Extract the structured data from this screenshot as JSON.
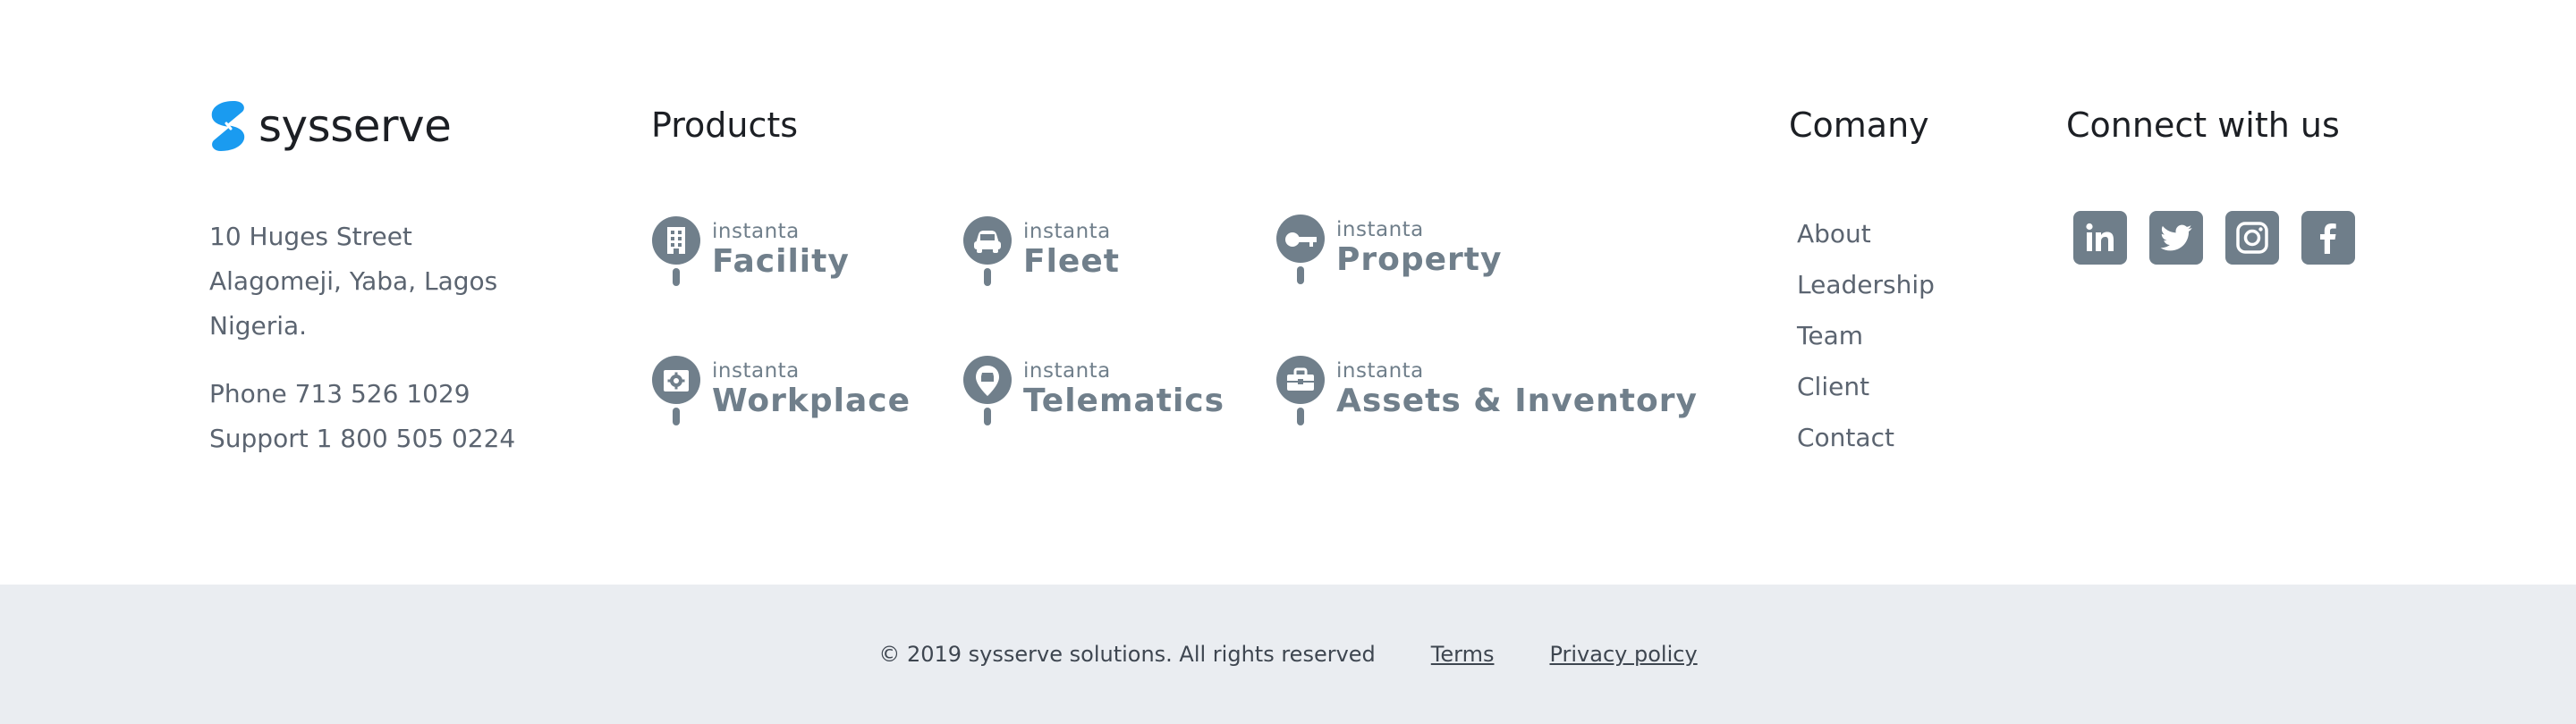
{
  "brand": {
    "name": "sysserve",
    "color": "#1a9bf0"
  },
  "address": {
    "street": "10 Huges Street",
    "area": "Alagomeji, Yaba, Lagos",
    "country": "Nigeria.",
    "phone": "Phone 713 526 1029",
    "support": "Support 1 800 505 0224"
  },
  "products": {
    "heading": "Products",
    "items": [
      {
        "brand": "instanta",
        "name": "Facility",
        "icon": "building-icon"
      },
      {
        "brand": "instanta",
        "name": "Fleet",
        "icon": "car-icon"
      },
      {
        "brand": "instanta",
        "name": "Property",
        "icon": "key-icon"
      },
      {
        "brand": "instanta",
        "name": "Workplace",
        "icon": "gear-box-icon"
      },
      {
        "brand": "instanta",
        "name": "Telematics",
        "icon": "location-pin-icon"
      },
      {
        "brand": "instanta",
        "name": "Assets & Inventory",
        "icon": "briefcase-icon"
      }
    ]
  },
  "company": {
    "heading": "Comany",
    "links": [
      "About",
      "Leadership",
      "Team",
      "Client",
      "Contact"
    ]
  },
  "connect": {
    "heading": "Connect with us",
    "icons": [
      "linkedin-icon",
      "twitter-icon",
      "instagram-icon",
      "facebook-icon"
    ],
    "color": "#6f7e8a"
  },
  "bottom": {
    "copyright": "© 2019 sysserve solutions. All rights reserved",
    "terms": "Terms",
    "privacy": "Privacy policy",
    "background": "#eaedf1"
  }
}
